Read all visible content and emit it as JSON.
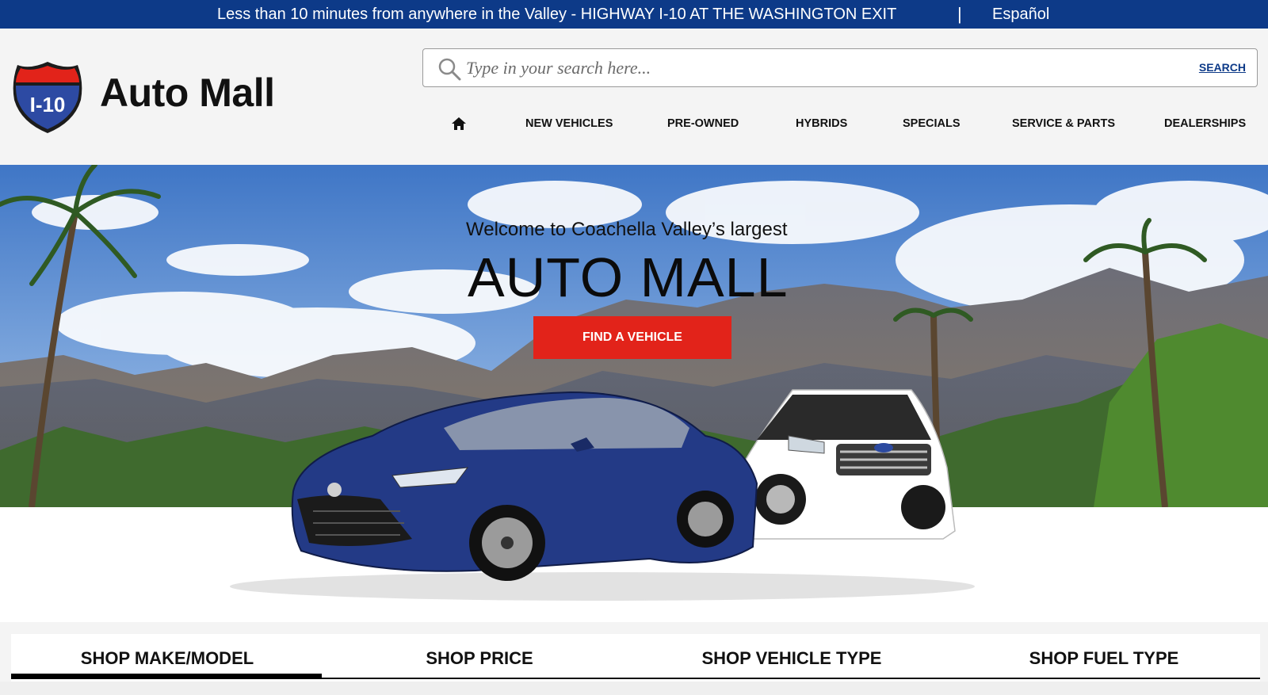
{
  "topbar": {
    "message": "Less than 10 minutes from anywhere in the Valley - HIGHWAY I-10 AT THE WASHINGTON EXIT",
    "separator": "|",
    "language_link": "Español",
    "background": "#0d3a88"
  },
  "logo": {
    "shield_text": "I-10",
    "name": "Auto Mall"
  },
  "search": {
    "placeholder": "Type in your search here...",
    "value": "",
    "button": "SEARCH",
    "icon": "search-icon"
  },
  "nav": {
    "home_icon": "home-icon",
    "items": [
      "NEW VEHICLES",
      "PRE-OWNED",
      "HYBRIDS",
      "SPECIALS",
      "SERVICE & PARTS",
      "DEALERSHIPS"
    ]
  },
  "hero": {
    "tagline": "Welcome to Coachella Valley’s largest",
    "title": "AUTO MALL",
    "cta": "FIND A VEHICLE",
    "cta_color": "#e2231a"
  },
  "shop_tabs": {
    "items": [
      "SHOP MAKE/MODEL",
      "SHOP PRICE",
      "SHOP VEHICLE TYPE",
      "SHOP FUEL TYPE"
    ],
    "active": "SHOP MAKE/MODEL"
  }
}
